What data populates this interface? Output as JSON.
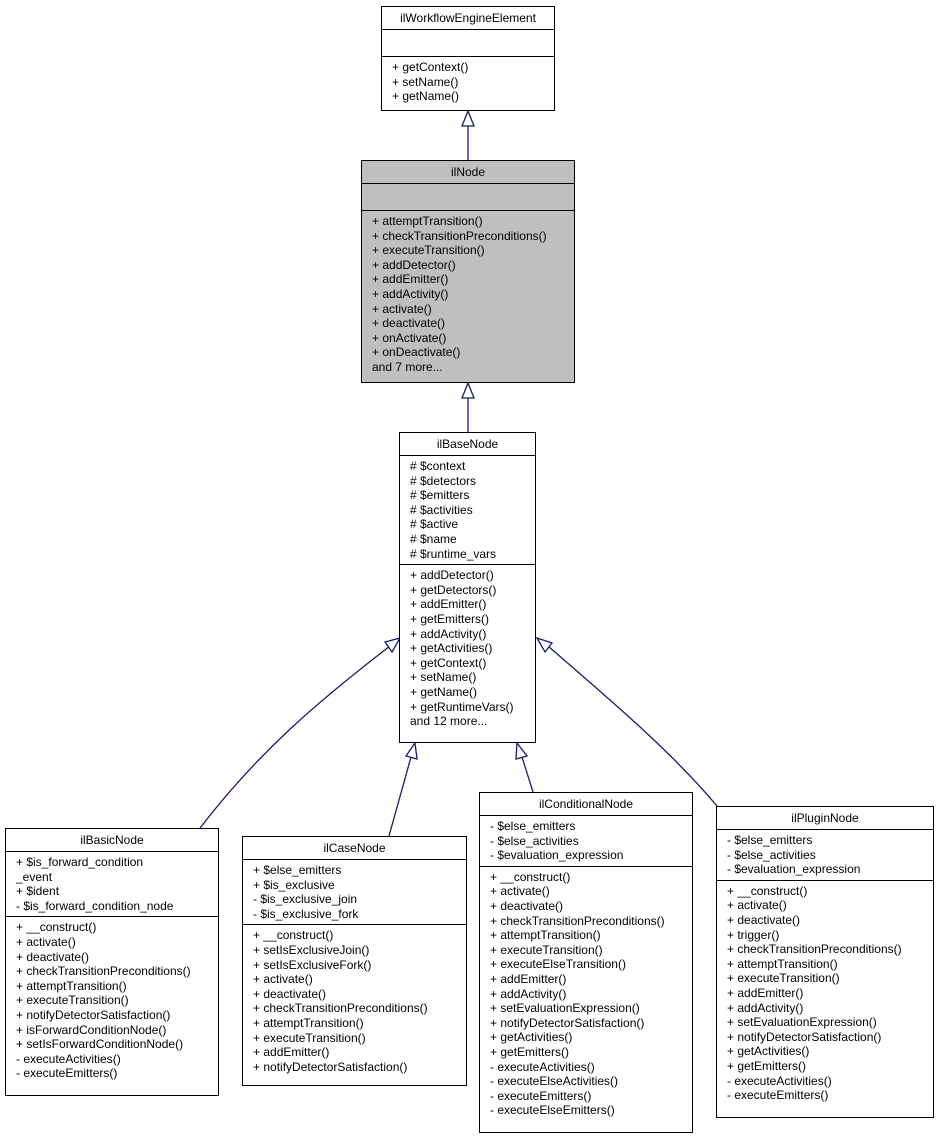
{
  "diagram": {
    "type": "uml-class-inheritance",
    "edge_color": "#191970",
    "highlight_color": "#bfbfbf",
    "classes": {
      "workflow_engine_element": {
        "name": "ilWorkflowEngineElement",
        "attributes": [],
        "operations": [
          "+ getContext()",
          "+ setName()",
          "+ getName()"
        ]
      },
      "node": {
        "name": "ilNode",
        "attributes": [],
        "operations": [
          "+ attemptTransition()",
          "+ checkTransitionPreconditions()",
          "+ executeTransition()",
          "+ addDetector()",
          "+ addEmitter()",
          "+ addActivity()",
          "+ activate()",
          "+ deactivate()",
          "+ onActivate()",
          "+ onDeactivate()",
          "and 7 more..."
        ]
      },
      "base_node": {
        "name": "ilBaseNode",
        "attributes": [
          "# $context",
          "# $detectors",
          "# $emitters",
          "# $activities",
          "# $active",
          "# $name",
          "# $runtime_vars"
        ],
        "operations": [
          "+ addDetector()",
          "+ getDetectors()",
          "+ addEmitter()",
          "+ getEmitters()",
          "+ addActivity()",
          "+ getActivities()",
          "+ getContext()",
          "+ setName()",
          "+ getName()",
          "+ getRuntimeVars()",
          "and 12 more..."
        ]
      },
      "basic_node": {
        "name": "ilBasicNode",
        "attributes": [
          "+ $is_forward_condition",
          "_event",
          "+ $ident",
          "- $is_forward_condition_node"
        ],
        "operations": [
          "+ __construct()",
          "+ activate()",
          "+ deactivate()",
          "+ checkTransitionPreconditions()",
          "+ attemptTransition()",
          "+ executeTransition()",
          "+ notifyDetectorSatisfaction()",
          "+ isForwardConditionNode()",
          "+ setIsForwardConditionNode()",
          "- executeActivities()",
          "- executeEmitters()"
        ]
      },
      "case_node": {
        "name": "ilCaseNode",
        "attributes": [
          "+ $else_emitters",
          "+ $is_exclusive",
          "- $is_exclusive_join",
          "- $is_exclusive_fork"
        ],
        "operations": [
          "+ __construct()",
          "+ setIsExclusiveJoin()",
          "+ setIsExclusiveFork()",
          "+ activate()",
          "+ deactivate()",
          "+ checkTransitionPreconditions()",
          "+ attemptTransition()",
          "+ executeTransition()",
          "+ addEmitter()",
          "+ notifyDetectorSatisfaction()"
        ]
      },
      "conditional_node": {
        "name": "ilConditionalNode",
        "attributes": [
          "- $else_emitters",
          "- $else_activities",
          "- $evaluation_expression"
        ],
        "operations": [
          "+ __construct()",
          "+ activate()",
          "+ deactivate()",
          "+ checkTransitionPreconditions()",
          "+ attemptTransition()",
          "+ executeTransition()",
          "+ executeElseTransition()",
          "+ addEmitter()",
          "+ addActivity()",
          "+ setEvaluationExpression()",
          "+ notifyDetectorSatisfaction()",
          "+ getActivities()",
          "+ getEmitters()",
          "- executeActivities()",
          "- executeElseActivities()",
          "- executeEmitters()",
          "- executeElseEmitters()"
        ]
      },
      "plugin_node": {
        "name": "ilPluginNode",
        "attributes": [
          "- $else_emitters",
          "- $else_activities",
          "- $evaluation_expression"
        ],
        "operations": [
          "+ __construct()",
          "+ activate()",
          "+ deactivate()",
          "+ trigger()",
          "+ checkTransitionPreconditions()",
          "+ attemptTransition()",
          "+ executeTransition()",
          "+ addEmitter()",
          "+ addActivity()",
          "+ setEvaluationExpression()",
          "+ notifyDetectorSatisfaction()",
          "+ getActivities()",
          "+ getEmitters()",
          "- executeActivities()",
          "- executeEmitters()"
        ]
      }
    },
    "inheritance": [
      {
        "child": "ilNode",
        "parent": "ilWorkflowEngineElement"
      },
      {
        "child": "ilBaseNode",
        "parent": "ilNode"
      },
      {
        "child": "ilBasicNode",
        "parent": "ilBaseNode"
      },
      {
        "child": "ilCaseNode",
        "parent": "ilBaseNode"
      },
      {
        "child": "ilConditionalNode",
        "parent": "ilBaseNode"
      },
      {
        "child": "ilPluginNode",
        "parent": "ilBaseNode"
      }
    ]
  }
}
